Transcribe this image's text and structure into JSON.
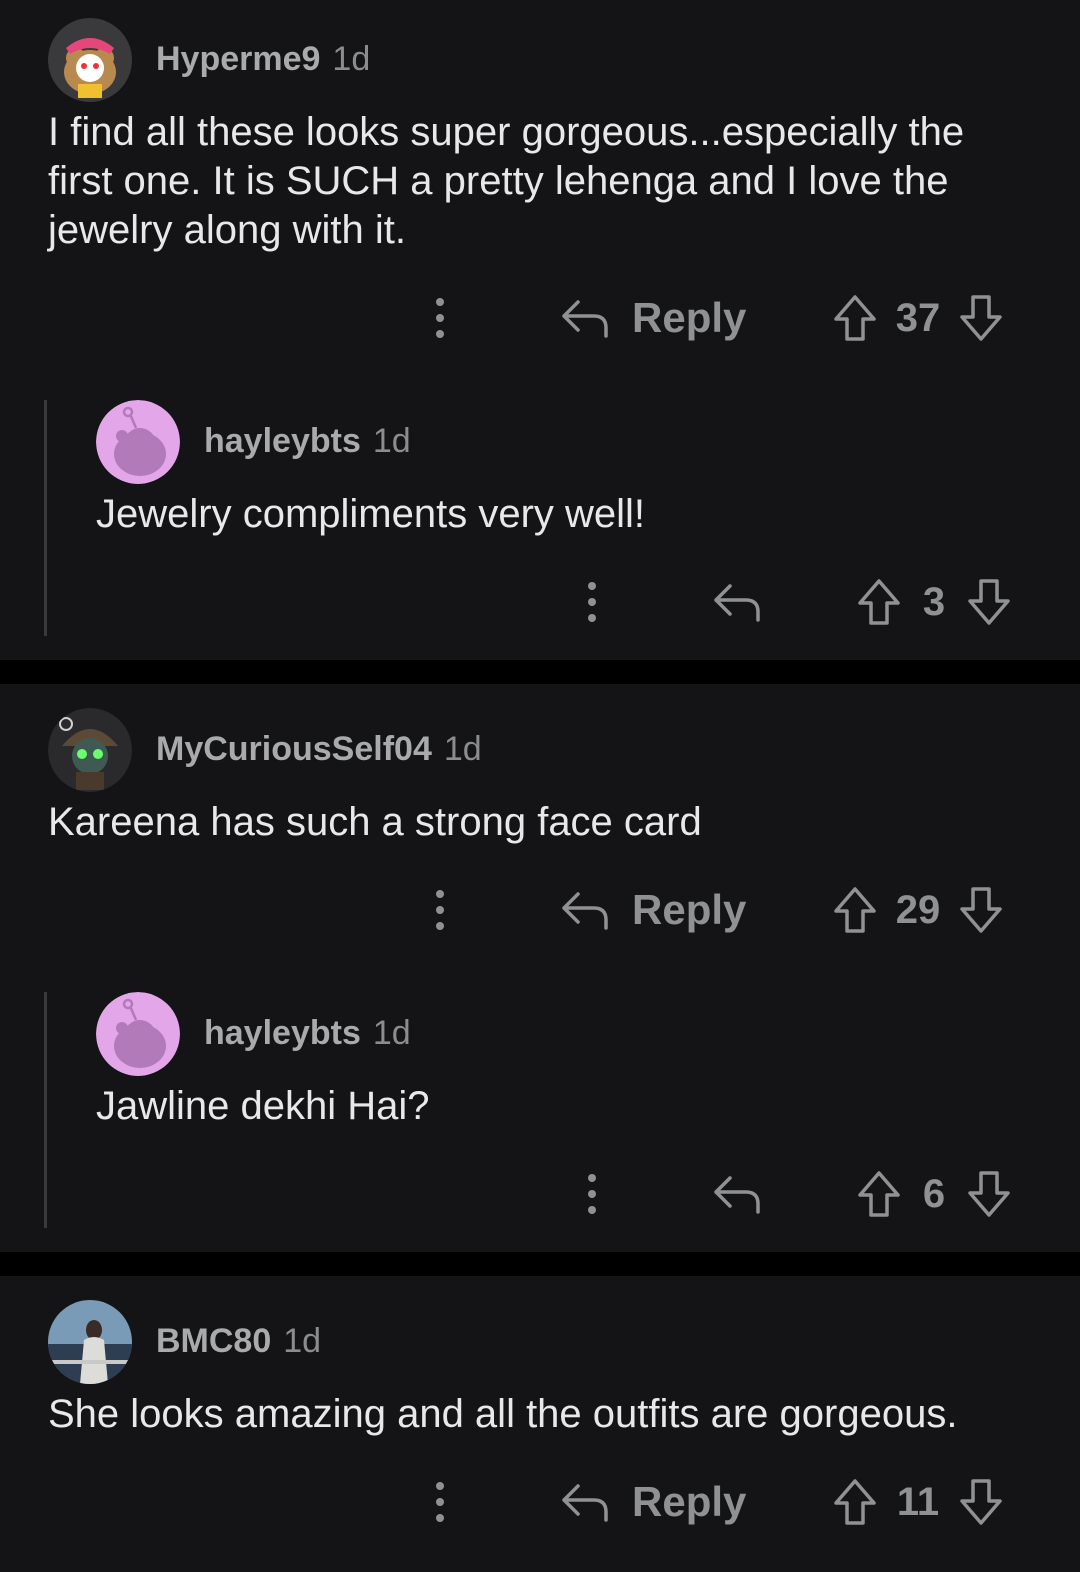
{
  "comments": [
    {
      "user": "Hyperme9",
      "time": "1d",
      "text": "I find all these looks super gorgeous...especially the first one. It is SUCH a pretty lehenga and I love the jewelry along with it.",
      "reply_label": "Reply",
      "votes": "37",
      "reply": {
        "user": "hayleybts",
        "time": "1d",
        "text": "Jewelry compliments very well!",
        "votes": "3"
      }
    },
    {
      "user": "MyCuriousSelf04",
      "time": "1d",
      "text": "Kareena has such a strong face card",
      "reply_label": "Reply",
      "votes": "29",
      "reply": {
        "user": "hayleybts",
        "time": "1d",
        "text": "Jawline dekhi Hai?",
        "votes": "6"
      }
    },
    {
      "user": "BMC80",
      "time": "1d",
      "text": "She looks amazing and all the outfits are gorgeous.",
      "reply_label": "Reply",
      "votes": "11"
    }
  ],
  "icons": {
    "more": "more-options-icon",
    "reply": "reply-arrow-icon",
    "upvote": "upvote-arrow-icon",
    "downvote": "downvote-arrow-icon"
  },
  "colors": {
    "background": "#141416",
    "separator": "#000000",
    "avatar_pink": "#e3a6e8"
  }
}
